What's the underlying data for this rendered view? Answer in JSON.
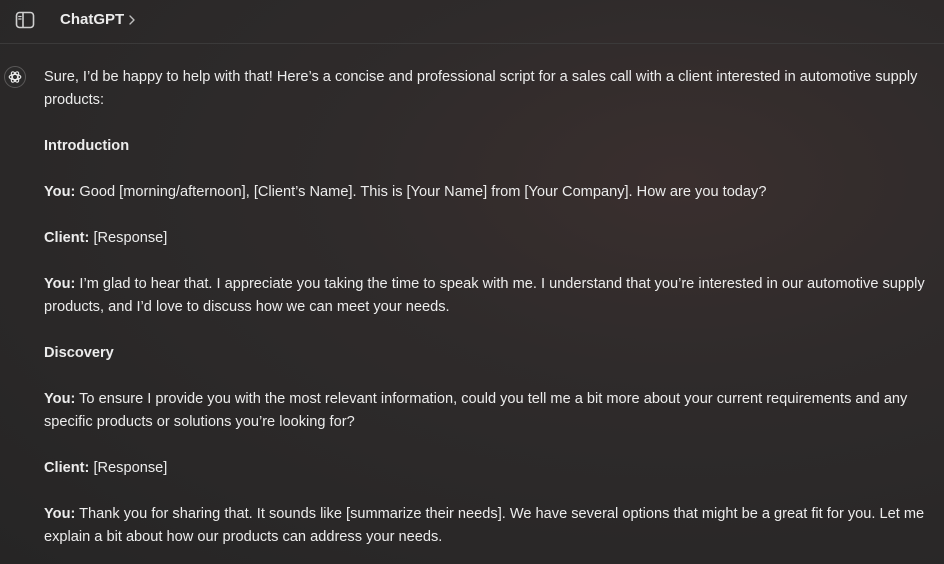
{
  "header": {
    "title": "ChatGPT",
    "sidebar_toggle_icon": "sidebar-toggle-icon",
    "title_chevron_icon": "chevron-right-icon"
  },
  "message": {
    "avatar_icon": "chatgpt-logo-icon",
    "intro": "Sure, I’d be happy to help with that! Here’s a concise and professional script for a sales call with a client interested in automotive supply products:",
    "section_introduction": "Introduction",
    "line1": {
      "speaker": "You:",
      "text": " Good [morning/afternoon], [Client’s Name]. This is [Your Name] from [Your Company]. How are you today?"
    },
    "line2": {
      "speaker": "Client:",
      "text": " [Response]"
    },
    "line3": {
      "speaker": "You:",
      "text": " I’m glad to hear that. I appreciate you taking the time to speak with me. I understand that you’re interested in our automotive supply products, and I’d love to discuss how we can meet your needs."
    },
    "section_discovery": "Discovery",
    "line4": {
      "speaker": "You:",
      "text": " To ensure I provide you with the most relevant information, could you tell me a bit more about your current requirements and any specific products or solutions you’re looking for?"
    },
    "line5": {
      "speaker": "Client:",
      "text": " [Response]"
    },
    "line6": {
      "speaker": "You:",
      "text": " Thank you for sharing that. It sounds like [summarize their needs]. We have several options that might be a great fit for you. Let me explain a bit about how our products can address your needs."
    }
  },
  "colors": {
    "text": "#ececec",
    "background": "#2a2828",
    "divider": "#3b3a3a"
  }
}
